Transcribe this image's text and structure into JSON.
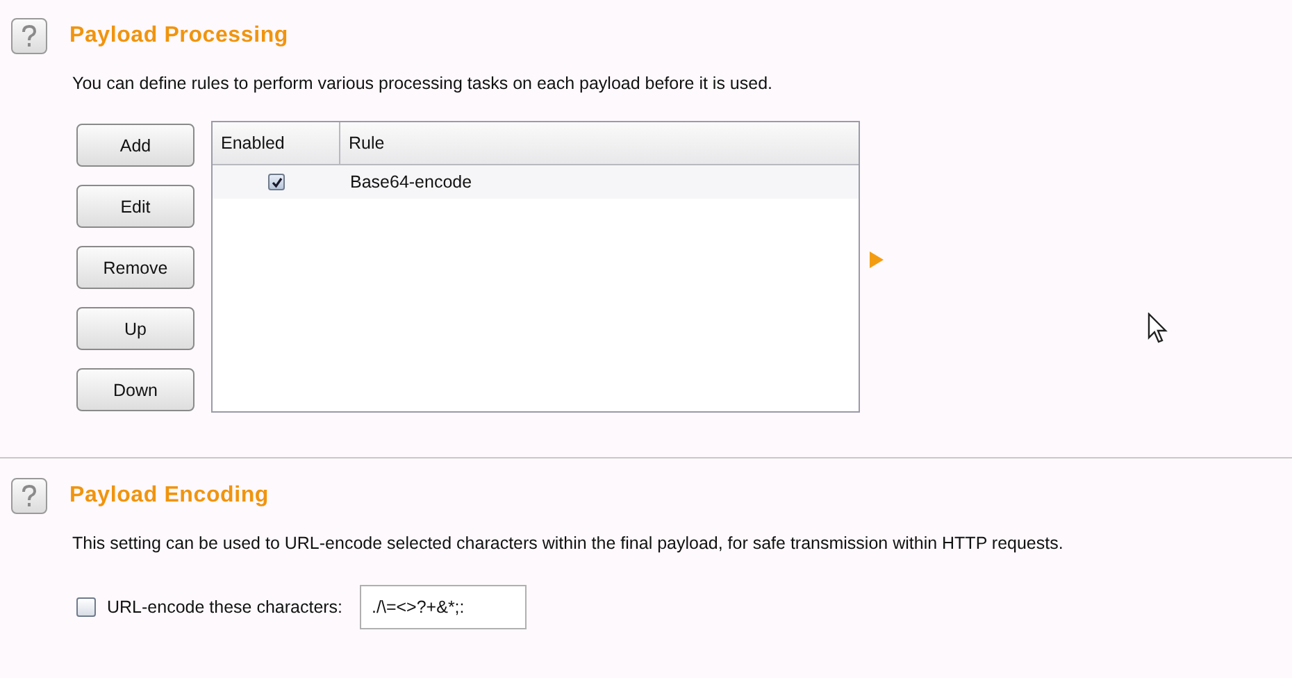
{
  "processing": {
    "title": "Payload Processing",
    "description": "You can define rules to perform various processing tasks on each payload before it is used.",
    "buttons": [
      "Add",
      "Edit",
      "Remove",
      "Up",
      "Down"
    ],
    "table": {
      "columns": [
        "Enabled",
        "Rule"
      ],
      "rows": [
        {
          "enabled": true,
          "rule": "Base64-encode"
        }
      ]
    }
  },
  "encoding": {
    "title": "Payload Encoding",
    "description": "This setting can be used to URL-encode selected characters within the final payload, for safe transmission within HTTP requests.",
    "option": {
      "label": "URL-encode these characters:",
      "checked": false,
      "value": "./\\=<>?+&*;:"
    }
  }
}
